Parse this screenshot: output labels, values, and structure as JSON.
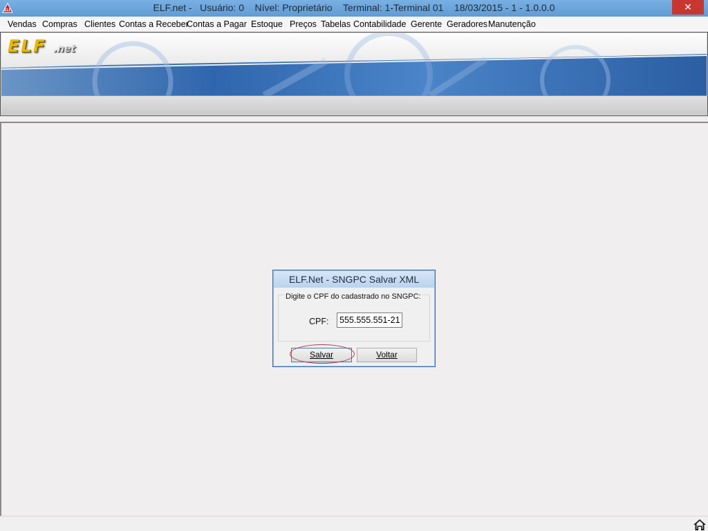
{
  "window": {
    "title": "ELF.net -   Usuário: 0    Nível: Proprietário    Terminal: 1-Terminal 01    18/03/2015 - 1 - 1.0.0.0",
    "close_label": "✕",
    "app_icon": "elf-logo-icon"
  },
  "menu": {
    "items": [
      "Vendas",
      "Compras",
      "Clientes",
      "Contas a Receber",
      "Contas a Pagar",
      "Estoque",
      "Preços",
      "Tabelas",
      "Contabilidade",
      "Gerente",
      "Geradores",
      "Manutenção"
    ]
  },
  "banner": {
    "logo_text": "ELF",
    "logo_suffix": ".net",
    "logo_color": "#e8b800"
  },
  "dialog": {
    "title": "ELF.Net - SNGPC Salvar XML",
    "group_label": "Digite o CPF do cadastrado no SNGPC:",
    "cpf_label": "CPF:",
    "cpf_value": "555.555.551-21",
    "save_button": "Salvar",
    "back_button": "Voltar"
  },
  "statusbar": {
    "home_icon": "home-icon"
  }
}
